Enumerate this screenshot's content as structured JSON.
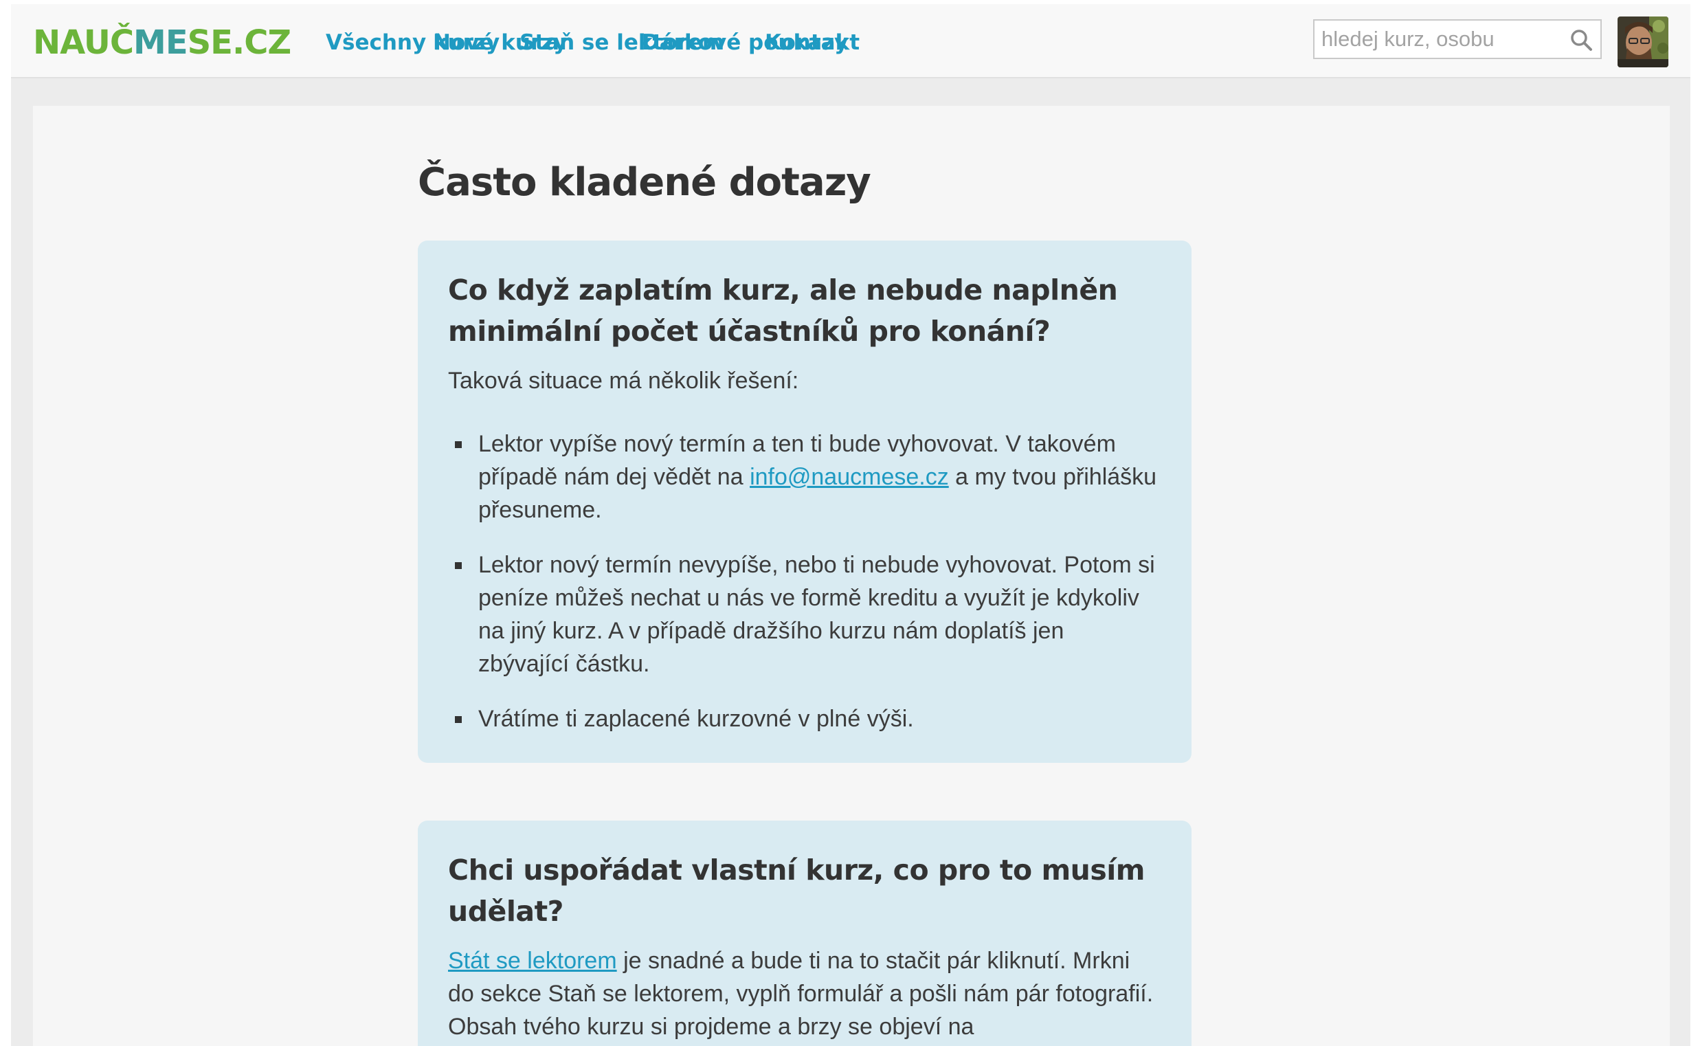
{
  "header": {
    "logo": {
      "part1": "NAUČ",
      "part2": "ME",
      "part3": "SE.CZ"
    },
    "nav": [
      {
        "label": "Všechny kurzy"
      },
      {
        "label": "Nové kurzy"
      },
      {
        "label": "Staň se lektorem"
      },
      {
        "label": "Dárkové poukazy"
      },
      {
        "label": "Kontakt"
      }
    ],
    "search": {
      "placeholder": "hledej kurz, osobu",
      "value": ""
    }
  },
  "main": {
    "title": "Často kladené dotazy",
    "faqs": [
      {
        "question": "Co když zaplatím kurz, ale nebude naplněn minimální počet účastníků pro konání?",
        "intro": "Taková situace má několik řešení:",
        "items": [
          {
            "before": "Lektor vypíše nový termín a ten ti bude vyhovovat. V takovém případě nám dej vědět na ",
            "link": "info@naucmese.cz",
            "after": " a my tvou přihlášku přesuneme."
          },
          {
            "text": "Lektor nový termín nevypíše, nebo ti nebude vyhovovat. Potom si peníze můžeš nechat u nás ve formě kreditu a využít je kdykoliv na jiný kurz. A v případě dražšího kurzu nám doplatíš jen zbývající částku."
          },
          {
            "text": "Vrátíme ti zaplacené kurzovné v plné výši."
          }
        ]
      },
      {
        "question": "Chci uspořádat vlastní kurz, co pro to musím udělat?",
        "link": "Stát se lektorem",
        "text": " je snadné a bude ti na to stačit pár kliknutí. Mrkni do sekce Staň se lektorem, vyplň formulář a pošli nám pár fotografií. Obsah tvého kurzu si projdeme a brzy se objeví na"
      }
    ]
  },
  "colors": {
    "logo_green": "#6cb43a",
    "logo_teal": "#3d9e9c",
    "link": "#1f9ac2",
    "card_bg": "#d9ebf2",
    "page_bg": "#f6f6f6",
    "text": "#333333"
  },
  "icons": {
    "search": "magnifier-icon",
    "avatar": "user-avatar"
  }
}
